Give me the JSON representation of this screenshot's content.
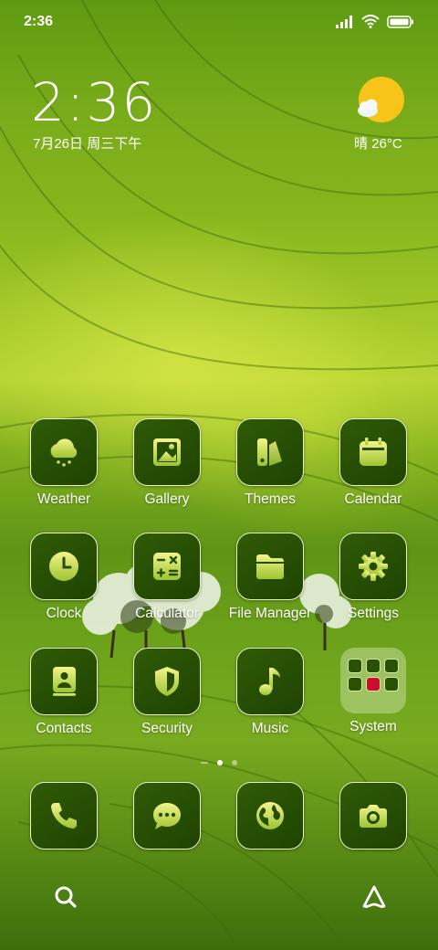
{
  "status_bar": {
    "time": "2:36"
  },
  "clock_widget": {
    "time": "2:36",
    "date": "7月26日 周三下午"
  },
  "weather_widget": {
    "text": "晴 26°C",
    "icon": "sunny-cloud-icon"
  },
  "apps": [
    {
      "label": "Weather",
      "icon": "weather-icon"
    },
    {
      "label": "Gallery",
      "icon": "gallery-icon"
    },
    {
      "label": "Themes",
      "icon": "themes-icon"
    },
    {
      "label": "Calendar",
      "icon": "calendar-icon"
    },
    {
      "label": "Clock",
      "icon": "clock-icon"
    },
    {
      "label": "Calculator",
      "icon": "calculator-icon"
    },
    {
      "label": "File Manager",
      "icon": "folder-icon"
    },
    {
      "label": "Settings",
      "icon": "gear-icon"
    },
    {
      "label": "Contacts",
      "icon": "contacts-icon"
    },
    {
      "label": "Security",
      "icon": "shield-icon"
    },
    {
      "label": "Music",
      "icon": "music-note-icon"
    },
    {
      "label": "System",
      "icon": "folder-group-icon"
    }
  ],
  "dock": [
    {
      "icon": "phone-icon"
    },
    {
      "icon": "messages-icon"
    },
    {
      "icon": "browser-globe-icon"
    },
    {
      "icon": "camera-icon"
    }
  ],
  "page_indicator": {
    "pages": 2,
    "current": 1
  },
  "bottom_bar": {
    "left_icon": "search-icon",
    "right_icon": "assistant-icon"
  },
  "colors": {
    "tile": "#2f5b06",
    "glyph_top": "#f4f48a",
    "glyph_bottom": "#9dc530"
  }
}
